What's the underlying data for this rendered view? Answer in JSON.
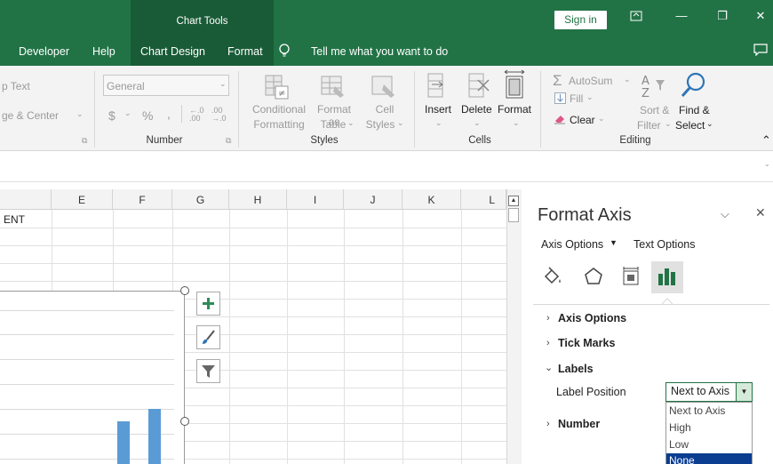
{
  "titlebar": {
    "context_tab": "Chart Tools",
    "sign_in": "Sign in",
    "minimize": "—",
    "restore": "❐",
    "close": "✕",
    "comment": "▭"
  },
  "tabs": {
    "developer": "Developer",
    "help": "Help",
    "chart_design": "Chart Design",
    "format": "Format",
    "tell_me": "Tell me what you want to do"
  },
  "ribbon": {
    "wrap_text": "p Text",
    "merge_center": "ge & Center",
    "number_format": "General",
    "currency": "$",
    "percent": "%",
    "comma": ",",
    "inc_decimal": "←.0 .00",
    "dec_decimal": ".00 →.0",
    "conditional_formatting_1": "Conditional",
    "conditional_formatting_2": "Formatting",
    "format_as_table_1": "Format as",
    "format_as_table_2": "Table",
    "cell_styles_1": "Cell",
    "cell_styles_2": "Styles",
    "insert": "Insert",
    "delete": "Delete",
    "format": "Format",
    "autosum": "AutoSum",
    "fill": "Fill",
    "clear": "Clear",
    "sort_filter_1": "Sort &",
    "sort_filter_2": "Filter",
    "find_select_1": "Find &",
    "find_select_2": "Select",
    "group_number": "Number",
    "group_styles": "Styles",
    "group_cells": "Cells",
    "group_editing": "Editing"
  },
  "grid": {
    "columns": [
      "E",
      "F",
      "G",
      "H",
      "I",
      "J",
      "K",
      "L"
    ],
    "cell_text": "ENT"
  },
  "pane": {
    "title": "Format Axis",
    "axis_options_tab": "Axis Options",
    "text_options_tab": "Text Options",
    "sections": {
      "axis_options": "Axis Options",
      "tick_marks": "Tick Marks",
      "labels": "Labels",
      "number": "Number"
    },
    "label_position_label": "Label Position",
    "label_position_value": "Next to Axis",
    "options": [
      "Next to Axis",
      "High",
      "Low",
      "None"
    ]
  },
  "colors": {
    "excel_green": "#217346",
    "bar_blue": "#5b9bd5",
    "dropdown_highlight": "#0b3d91"
  }
}
